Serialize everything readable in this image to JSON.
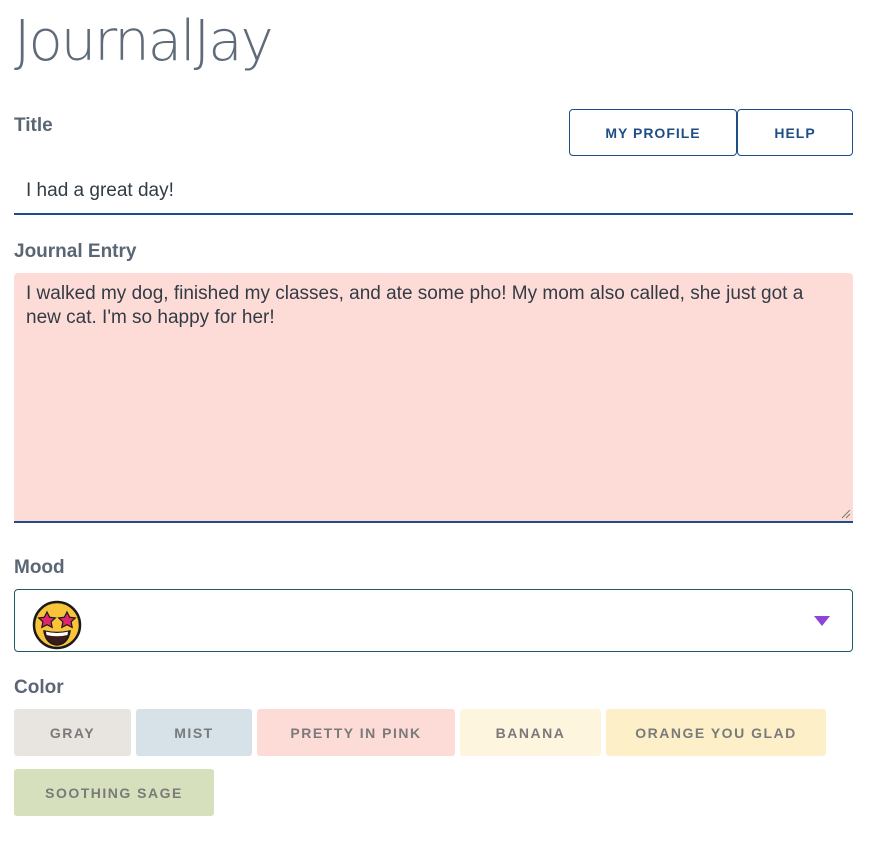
{
  "app": {
    "title": "JournalJay"
  },
  "nav": {
    "profile_label": "MY PROFILE",
    "help_label": "HELP"
  },
  "form": {
    "title_label": "Title",
    "title_value": "I had a great day!",
    "entry_label": "Journal Entry",
    "entry_value": "I walked my dog, finished my classes, and ate some pho! My mom also called, she just got a new cat. I'm so happy for her!",
    "mood_label": "Mood",
    "mood_selected_icon": "star-struck-face-icon",
    "color_label": "Color"
  },
  "colors": {
    "accent": "#1f4e86",
    "entry_background": "#fddcd8",
    "caret": "#8e44d6",
    "options": [
      {
        "label": "GRAY",
        "hex": "#e8e4df"
      },
      {
        "label": "MIST",
        "hex": "#d6e1e8"
      },
      {
        "label": "PRETTY IN PINK",
        "hex": "#fddcd8"
      },
      {
        "label": "BANANA",
        "hex": "#fdf5dd"
      },
      {
        "label": "ORANGE YOU GLAD",
        "hex": "#fdefc8"
      },
      {
        "label": "SOOTHING SAGE",
        "hex": "#d6e0bc"
      }
    ]
  }
}
